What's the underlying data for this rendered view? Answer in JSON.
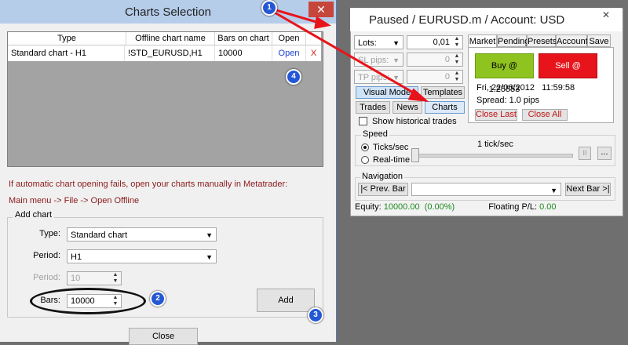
{
  "dialog": {
    "title": "Charts Selection",
    "close_glyph": "✕",
    "table": {
      "headers": [
        "Type",
        "Offline chart name",
        "Bars on chart",
        "Open"
      ],
      "row": {
        "type": "Standard chart - H1",
        "name": "!STD_EURUSD,H1",
        "bars": "10000",
        "open": "Open",
        "delete": "X"
      }
    },
    "info_line1": "If automatic chart opening fails, open your charts manually in Metatrader:",
    "info_line2": "Main menu -> File -> Open Offline",
    "group_label": "Add chart",
    "type_label": "Type:",
    "type_value": "Standard chart",
    "period_label": "Period:",
    "period_value": "H1",
    "period2_label": "Period:",
    "period2_value": "10",
    "bars_label": "Bars:",
    "bars_value": "10000",
    "add_label": "Add",
    "close_label": "Close"
  },
  "panel": {
    "title": "Paused / EURUSD.m / Account: USD",
    "close_glyph": "✕",
    "lots_label": "Lots:",
    "lots_value": "0,01",
    "sl_label": "SL pips:",
    "sl_value": "0",
    "tp_label": "TP pips:",
    "tp_value": "0",
    "tabs": [
      "Market",
      "Pending",
      "Presets",
      "Account",
      "Save"
    ],
    "buy_label": "Buy @ 1.25553",
    "sell_label": "Sell @ 1.25543",
    "datetime": "Fri, 22/06/2012   11:59:58",
    "spread": "Spread:  1.0 pips",
    "close_last": "Close Last",
    "close_all": "Close All",
    "visual_mode": "Visual Mode",
    "templates": "Templates",
    "trades": "Trades",
    "news": "News",
    "charts": "Charts",
    "show_hist": "Show historical trades",
    "speed_label": "Speed",
    "ticks_label": "Ticks/sec",
    "realtime_label": "Real-time",
    "tick_rate": "1 tick/sec",
    "pause_glyph": "II",
    "more_glyph": "...",
    "nav_label": "Navigation",
    "prev_bar": "|< Prev. Bar",
    "next_bar": "Next Bar >|",
    "equity_label": "Equity:",
    "equity_value": "10000.00  (0.00%)",
    "floating_label": "Floating P/L:",
    "floating_value": "0.00"
  },
  "badges": [
    "1",
    "2",
    "3",
    "4"
  ],
  "colors": {
    "buy_bg": "#8fc31f",
    "sell_bg": "#e8141b",
    "equity_green": "#1e8a1e",
    "arrow_red": "#e8141b",
    "badge_blue": "#2457d6"
  }
}
